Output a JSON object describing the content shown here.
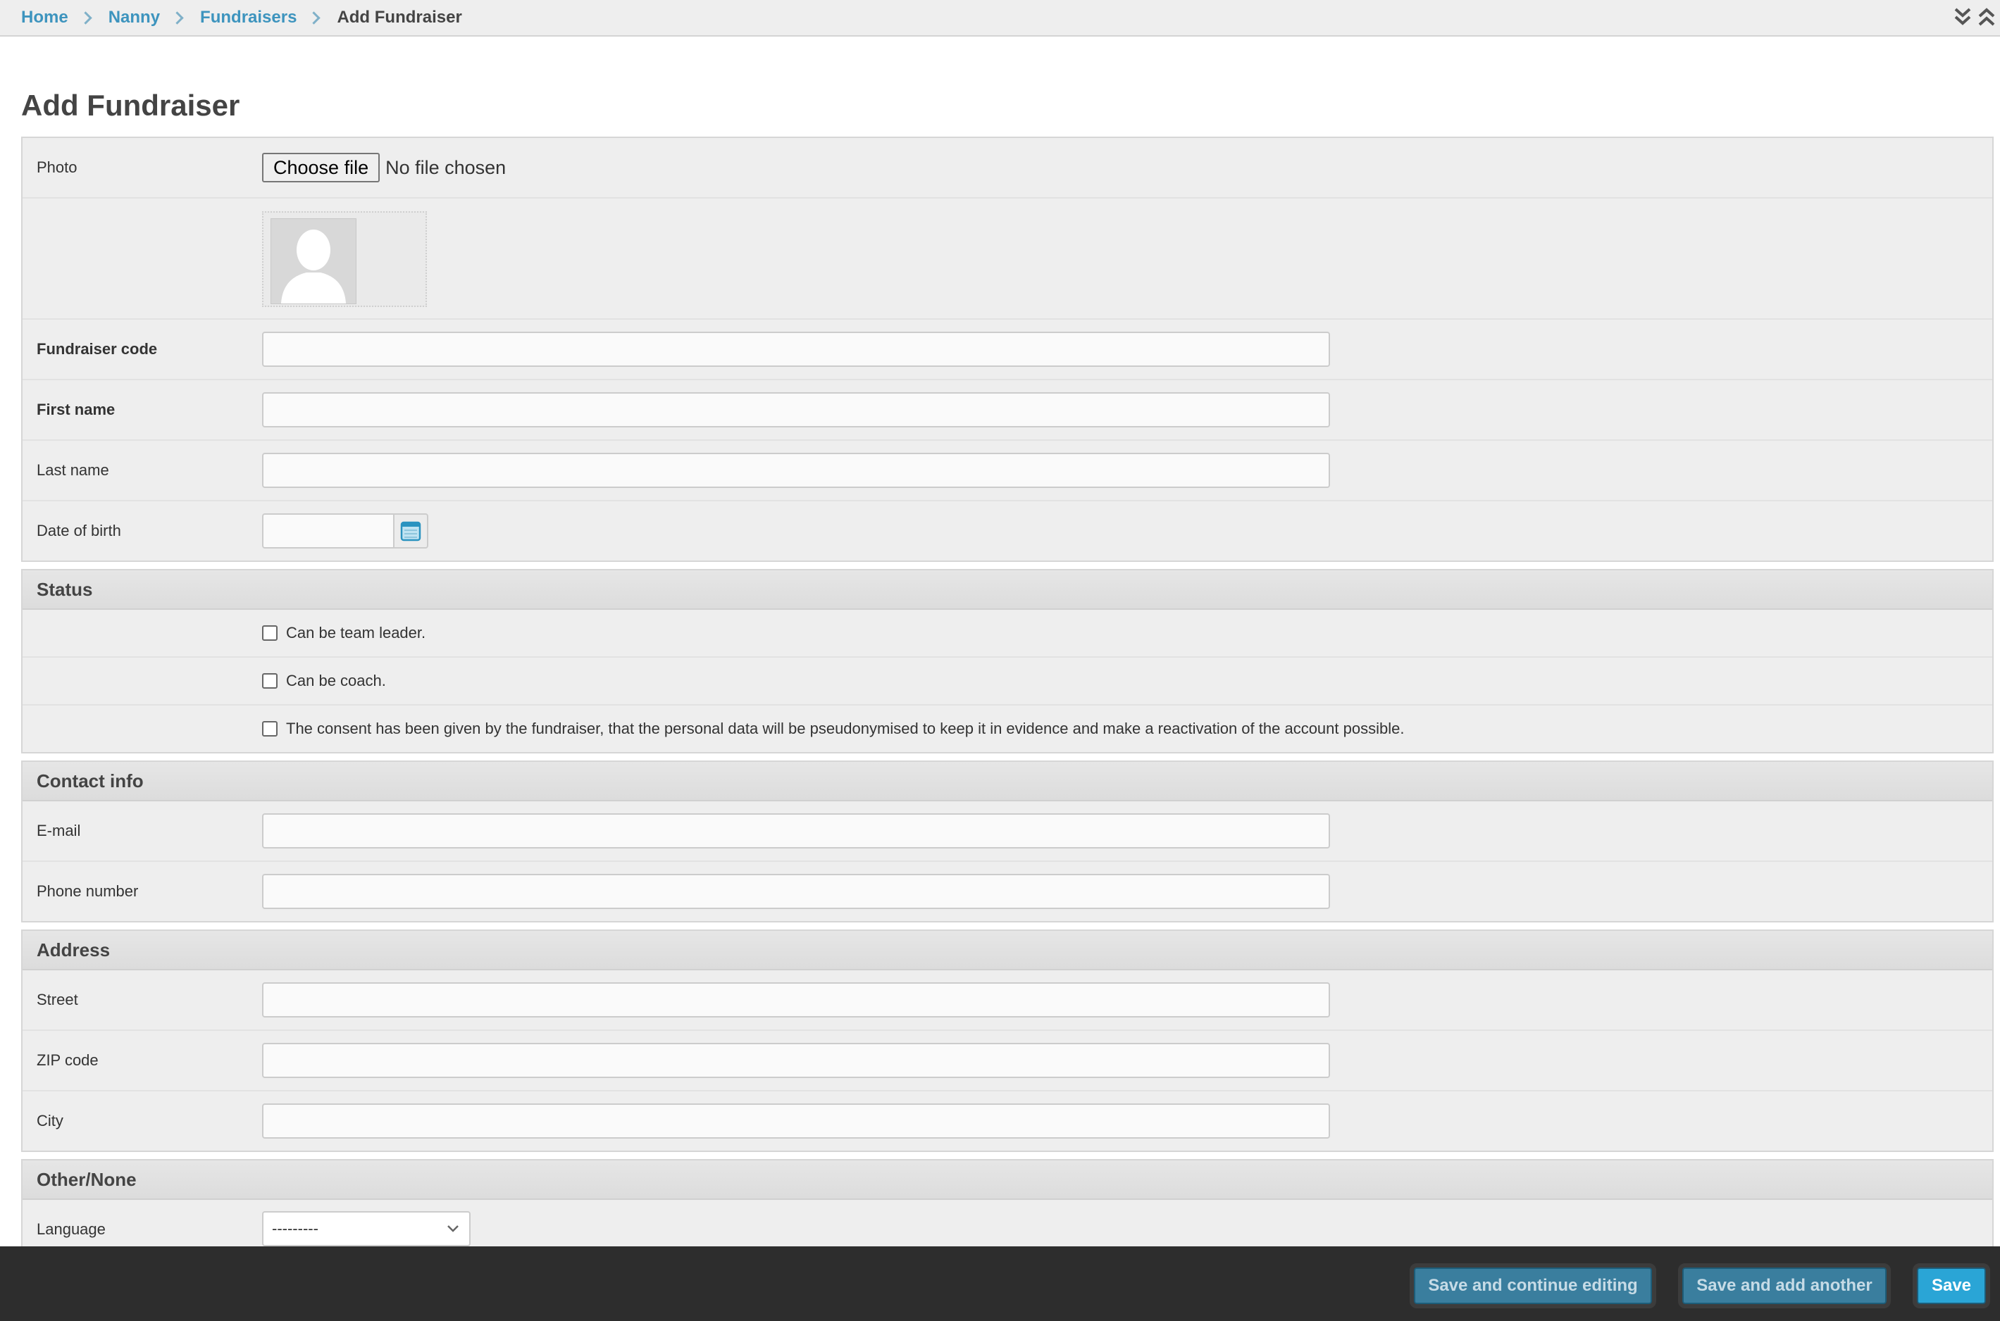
{
  "breadcrumb": {
    "items": [
      "Home",
      "Nanny",
      "Fundraisers"
    ],
    "current": "Add Fundraiser"
  },
  "page": {
    "title": "Add Fundraiser"
  },
  "main_fields": {
    "photo_label": "Photo",
    "file_button": "Choose file",
    "file_status": "No file chosen",
    "fundraiser_code_label": "Fundraiser code",
    "first_name_label": "First name",
    "last_name_label": "Last name",
    "date_of_birth_label": "Date of birth"
  },
  "status": {
    "title": "Status",
    "checkboxes": [
      "Can be team leader.",
      "Can be coach.",
      "The consent has been given by the fundraiser, that the personal data will be pseudonymised to keep it in evidence and make a reactivation of the account possible."
    ]
  },
  "contact": {
    "title": "Contact info",
    "email_label": "E-mail",
    "phone_label": "Phone number"
  },
  "address": {
    "title": "Address",
    "street_label": "Street",
    "zip_label": "ZIP code",
    "city_label": "City"
  },
  "other": {
    "title": "Other/None",
    "language_label": "Language",
    "language_value": "---------"
  },
  "submit": {
    "save_continue": "Save and continue editing",
    "save_add_another": "Save and add another",
    "save": "Save"
  },
  "colors": {
    "link": "#3d94be",
    "primary_button": "#2aa5d6",
    "secondary_button": "#3a7e9e",
    "footer_bar": "#2d2d2d"
  },
  "icons": {
    "breadcrumb_separator": "chevron-right-icon",
    "expand_all": "double-chevron-down-icon",
    "collapse_all": "double-chevron-up-icon",
    "date_picker": "calendar-icon",
    "select_arrow": "chevron-down-icon",
    "photo_placeholder": "avatar-placeholder-icon"
  }
}
